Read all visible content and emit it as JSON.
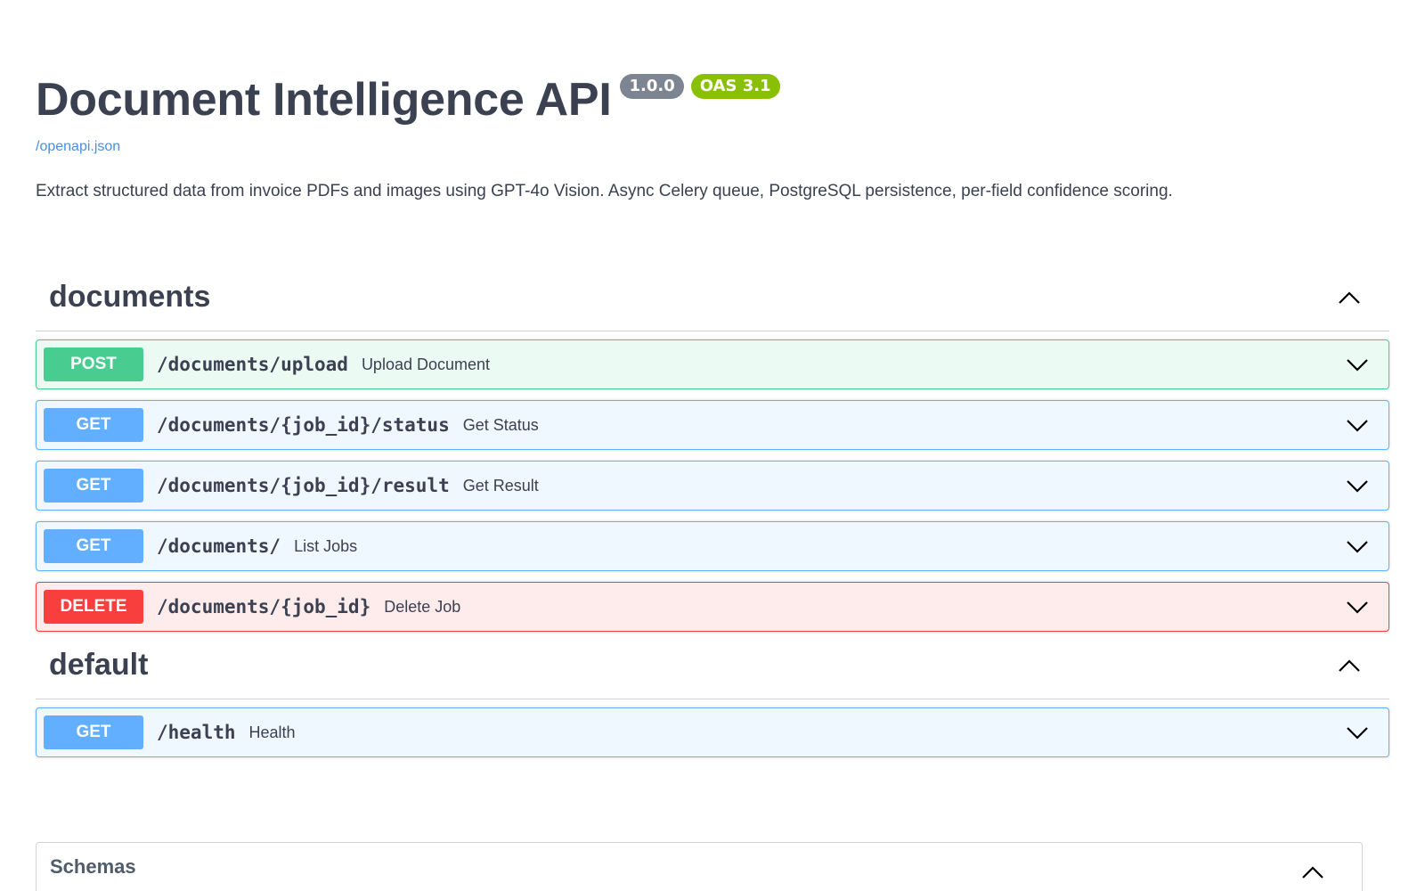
{
  "info": {
    "title": "Document Intelligence API",
    "version": "1.0.0",
    "oas": "OAS 3.1",
    "spec_link": "/openapi.json",
    "description": "Extract structured data from invoice PDFs and images using GPT-4o Vision. Async Celery queue, PostgreSQL persistence, per-field confidence scoring."
  },
  "tags": [
    {
      "name": "documents",
      "operations": [
        {
          "method": "POST",
          "path": "/documents/upload",
          "summary": "Upload Document"
        },
        {
          "method": "GET",
          "path": "/documents/{job_id}/status",
          "summary": "Get Status"
        },
        {
          "method": "GET",
          "path": "/documents/{job_id}/result",
          "summary": "Get Result"
        },
        {
          "method": "GET",
          "path": "/documents/",
          "summary": "List Jobs"
        },
        {
          "method": "DELETE",
          "path": "/documents/{job_id}",
          "summary": "Delete Job"
        }
      ]
    },
    {
      "name": "default",
      "operations": [
        {
          "method": "GET",
          "path": "/health",
          "summary": "Health"
        }
      ]
    }
  ],
  "schemas": {
    "title": "Schemas"
  },
  "colors": {
    "post": "#49cc90",
    "get": "#61affe",
    "delete": "#f93e3e",
    "version_badge": "#7d8492",
    "oas_badge": "#89bf04",
    "link": "#4990e2"
  },
  "icons": {
    "collapse": "chevron-up-icon",
    "expand": "chevron-down-icon"
  }
}
